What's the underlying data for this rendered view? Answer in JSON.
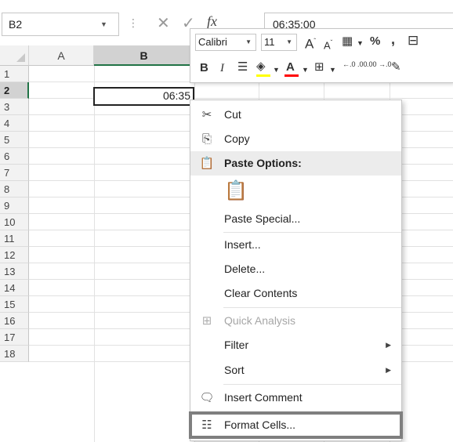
{
  "formula_bar": {
    "name_box": "B2",
    "cancel_icon": "x-icon",
    "enter_icon": "checkmark-icon",
    "fx_label": "fx",
    "formula": "06:35:00"
  },
  "grid": {
    "columns": [
      "A",
      "B"
    ],
    "rows": [
      "1",
      "2",
      "3",
      "4",
      "5",
      "6",
      "7",
      "8",
      "9",
      "10",
      "11",
      "12",
      "13",
      "14",
      "15",
      "16",
      "17",
      "18"
    ],
    "active_cell": "B2",
    "cell_b2_value": "06:35"
  },
  "mini_toolbar": {
    "font_name": "Calibri",
    "font_size": "11",
    "increase_font": "A",
    "decrease_font": "A",
    "percent": "%",
    "comma": ",",
    "bold": "B",
    "italic": "I",
    "font_color_letter": "A",
    "increase_decimal": "←.0 .00",
    "decrease_decimal": ".00 →.0",
    "fill_color": "#FFFF00",
    "font_color": "#FF0000"
  },
  "context_menu": {
    "cut": "Cut",
    "copy": "Copy",
    "paste_options": "Paste Options:",
    "paste_special": "Paste Special...",
    "insert": "Insert...",
    "delete": "Delete...",
    "clear_contents": "Clear Contents",
    "quick_analysis": "Quick Analysis",
    "filter": "Filter",
    "sort": "Sort",
    "insert_comment": "Insert Comment",
    "format_cells": "Format Cells..."
  }
}
